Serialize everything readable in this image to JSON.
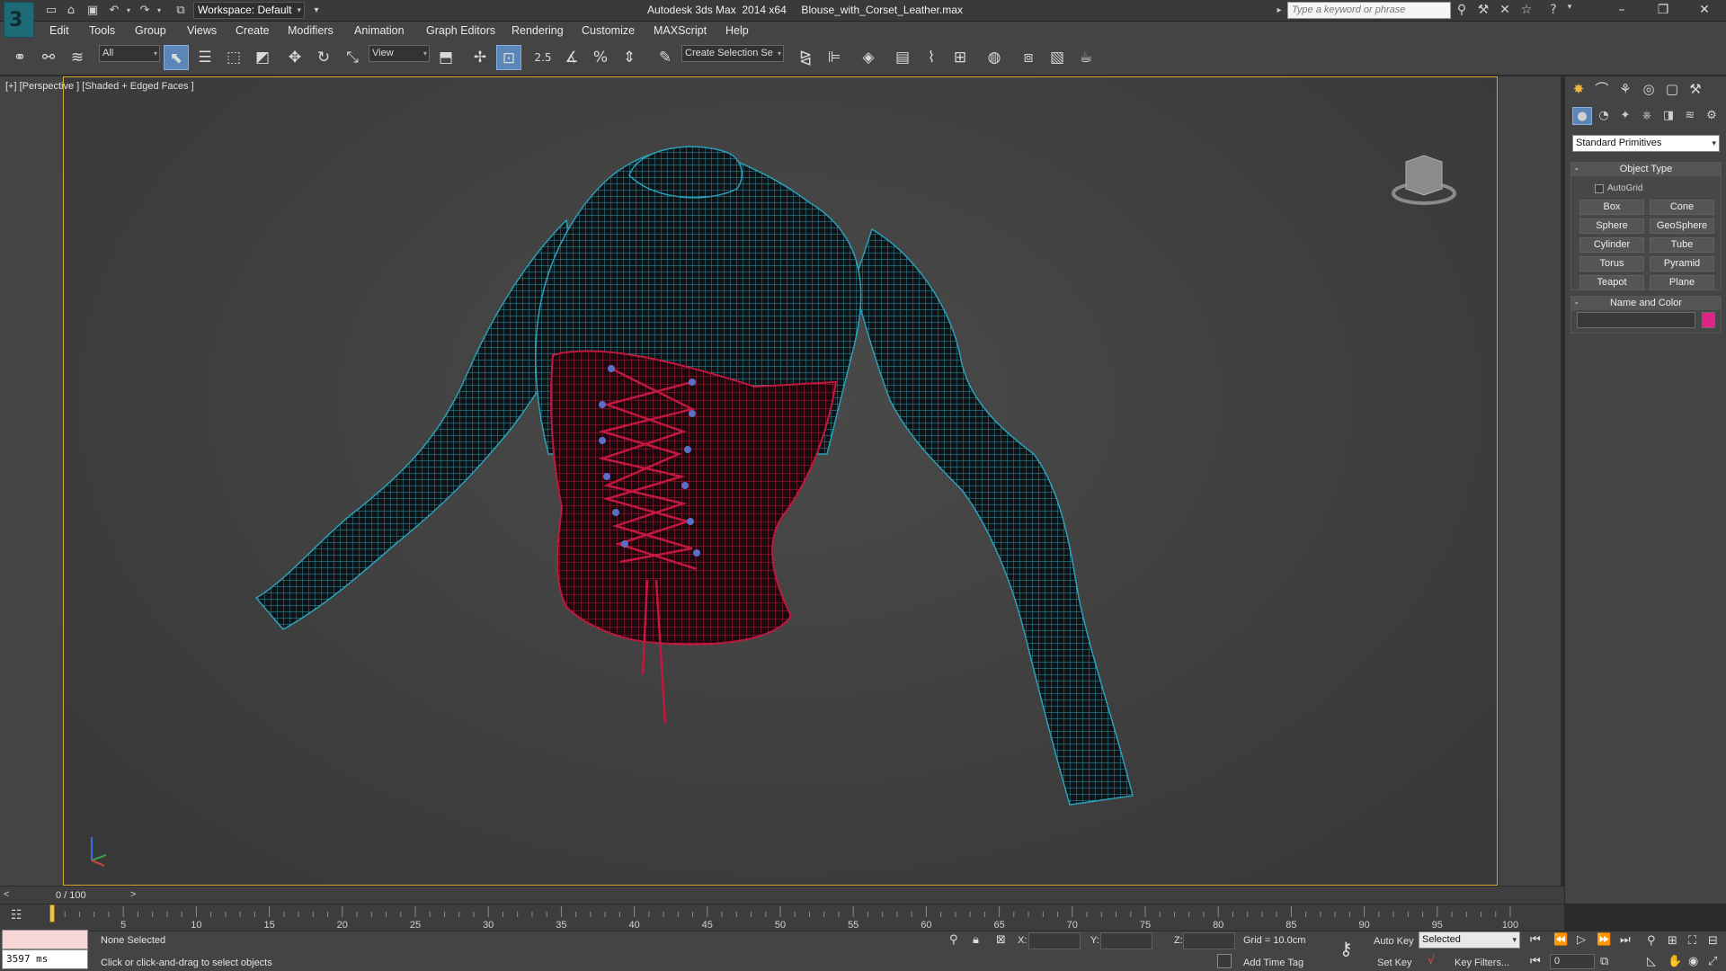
{
  "app": {
    "title": "Autodesk 3ds Max  2014 x64     Blouse_with_Corset_Leather.max",
    "workspace": "Workspace: Default",
    "search_placeholder": "Type a keyword or phrase"
  },
  "menu": [
    "Edit",
    "Tools",
    "Group",
    "Views",
    "Create",
    "Modifiers",
    "Animation",
    "Graph Editors",
    "Rendering",
    "Customize",
    "MAXScript",
    "Help"
  ],
  "toolbar": {
    "selection_filter": "All",
    "ref_coord": "View",
    "snap_value": "2.5",
    "named_selection": "Create Selection Se"
  },
  "viewport": {
    "label": "[+] [Perspective ] [Shaded + Edged Faces ]",
    "objects": {
      "blouse_color": "#2aa0b8",
      "corset_color": "#c0183e"
    }
  },
  "command_panel": {
    "dropdown": "Standard Primitives",
    "object_type": {
      "title": "Object Type",
      "autogrid": "AutoGrid",
      "buttons": [
        "Box",
        "Cone",
        "Sphere",
        "GeoSphere",
        "Cylinder",
        "Tube",
        "Torus",
        "Pyramid",
        "Teapot",
        "Plane"
      ]
    },
    "name_color": {
      "title": "Name and Color",
      "swatch_color": "#e02487"
    }
  },
  "timeslider": {
    "prev": "<",
    "frame": "0 / 100",
    "next": ">"
  },
  "trackbar": {
    "ticks": [
      "5",
      "10",
      "15",
      "20",
      "25",
      "30",
      "35",
      "40",
      "45",
      "50",
      "55",
      "60",
      "65",
      "70",
      "75",
      "80",
      "85",
      "90",
      "95",
      "100"
    ]
  },
  "status": {
    "selection": "None Selected",
    "prompt": "Click or click-and-drag to select objects",
    "render_time": "3597 ms",
    "x_label": "X:",
    "y_label": "Y:",
    "z_label": "Z:",
    "grid": "Grid = 10.0cm",
    "add_time_tag": "Add Time Tag",
    "auto_key": "Auto Key",
    "set_key": "Set Key",
    "key_mode": "Selected",
    "key_filters": "Key Filters...",
    "current_frame": "0"
  }
}
